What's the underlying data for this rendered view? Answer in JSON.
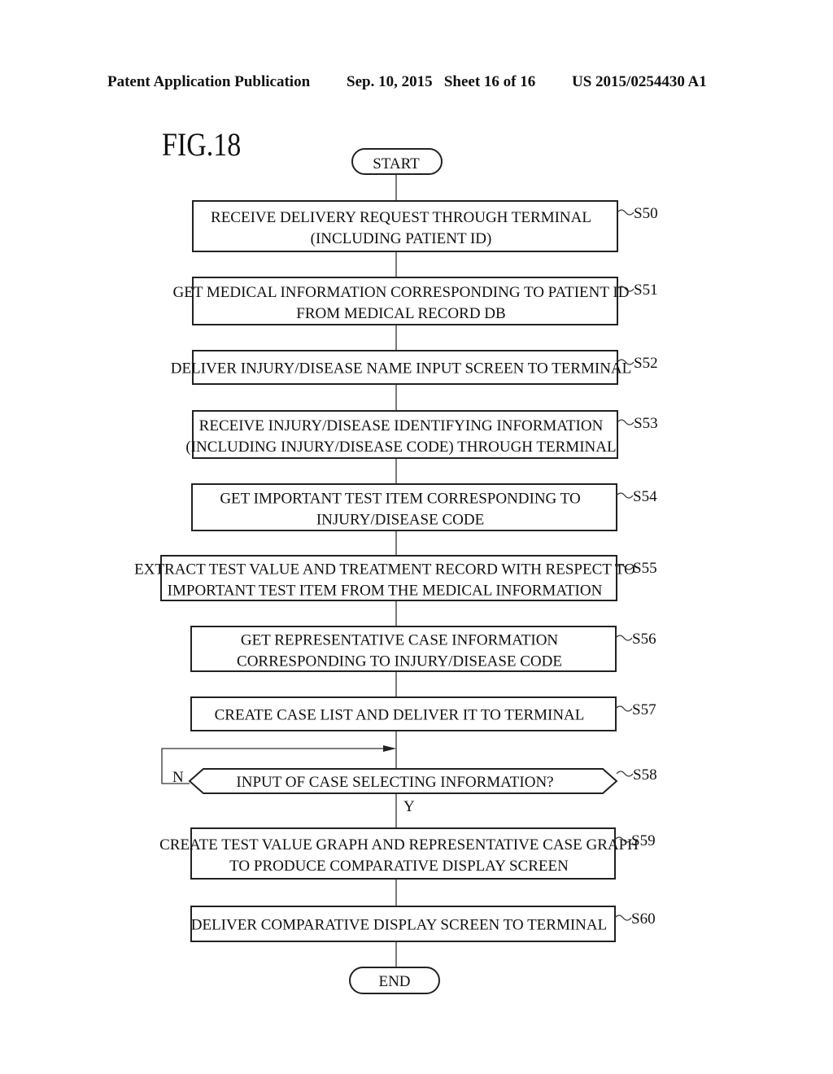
{
  "header": {
    "publication": "Patent Application Publication",
    "date_sheet": "Sep. 10, 2015   Sheet 16 of 16",
    "number": "US 2015/0254430 A1"
  },
  "figure": {
    "label": "FIG.18",
    "start": "START",
    "end": "END",
    "steps": [
      {
        "id": "S50",
        "lines": [
          "RECEIVE DELIVERY REQUEST THROUGH TERMINAL",
          "(INCLUDING PATIENT ID)"
        ]
      },
      {
        "id": "S51",
        "lines": [
          "GET MEDICAL INFORMATION CORRESPONDING TO PATIENT ID",
          "FROM MEDICAL RECORD DB"
        ]
      },
      {
        "id": "S52",
        "lines": [
          "DELIVER INJURY/DISEASE NAME INPUT SCREEN TO TERMINAL"
        ]
      },
      {
        "id": "S53",
        "lines": [
          "RECEIVE INJURY/DISEASE IDENTIFYING INFORMATION",
          "(INCLUDING INJURY/DISEASE CODE) THROUGH TERMINAL"
        ]
      },
      {
        "id": "S54",
        "lines": [
          "GET IMPORTANT TEST ITEM CORRESPONDING TO",
          "INJURY/DISEASE CODE"
        ]
      },
      {
        "id": "S55",
        "lines": [
          "EXTRACT TEST VALUE AND TREATMENT RECORD WITH RESPECT TO",
          "IMPORTANT TEST ITEM FROM THE MEDICAL INFORMATION"
        ]
      },
      {
        "id": "S56",
        "lines": [
          "GET REPRESENTATIVE CASE INFORMATION",
          "CORRESPONDING TO INJURY/DISEASE CODE"
        ]
      },
      {
        "id": "S57",
        "lines": [
          "CREATE CASE LIST AND DELIVER IT TO TERMINAL"
        ]
      },
      {
        "id": "S58",
        "type": "decision",
        "lines": [
          "INPUT OF CASE SELECTING INFORMATION?"
        ],
        "no_label": "N",
        "yes_label": "Y"
      },
      {
        "id": "S59",
        "lines": [
          "CREATE TEST VALUE GRAPH AND REPRESENTATIVE CASE GRAPH",
          "TO PRODUCE COMPARATIVE DISPLAY SCREEN"
        ]
      },
      {
        "id": "S60",
        "lines": [
          "DELIVER COMPARATIVE DISPLAY SCREEN TO TERMINAL"
        ]
      }
    ]
  }
}
